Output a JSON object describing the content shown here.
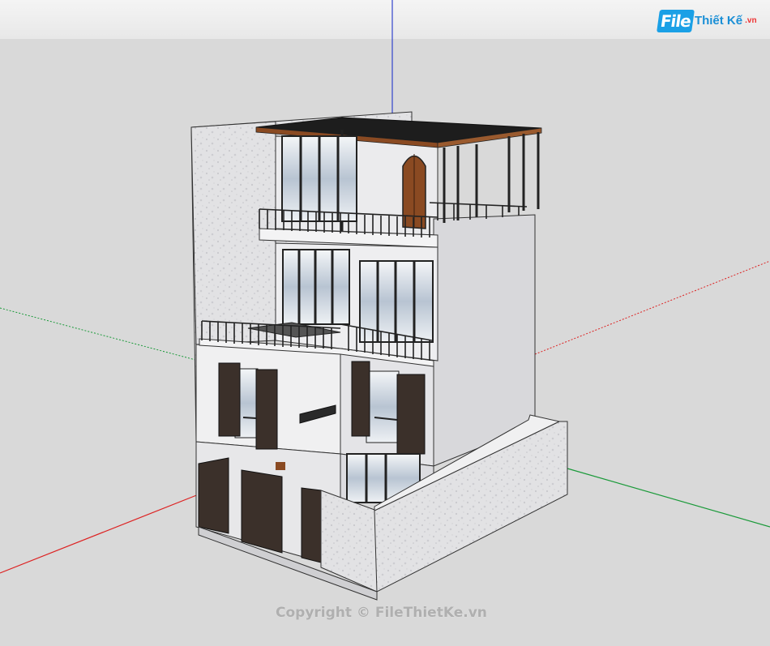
{
  "logo": {
    "file": "File",
    "name": "Thiết Kế",
    "domain": ".vn"
  },
  "watermark": {
    "text": "Copyright © FileThietKe.vn"
  },
  "colors": {
    "background": "#d9d9d9",
    "wall": "#e9e9ea",
    "wall_shade": "#cfcfd2",
    "shutter": "#3b302a",
    "pergola_roof": "#8a4a22",
    "axis_red": "#d22",
    "axis_green": "#1b9a3a",
    "axis_blue": "#3344cc"
  }
}
